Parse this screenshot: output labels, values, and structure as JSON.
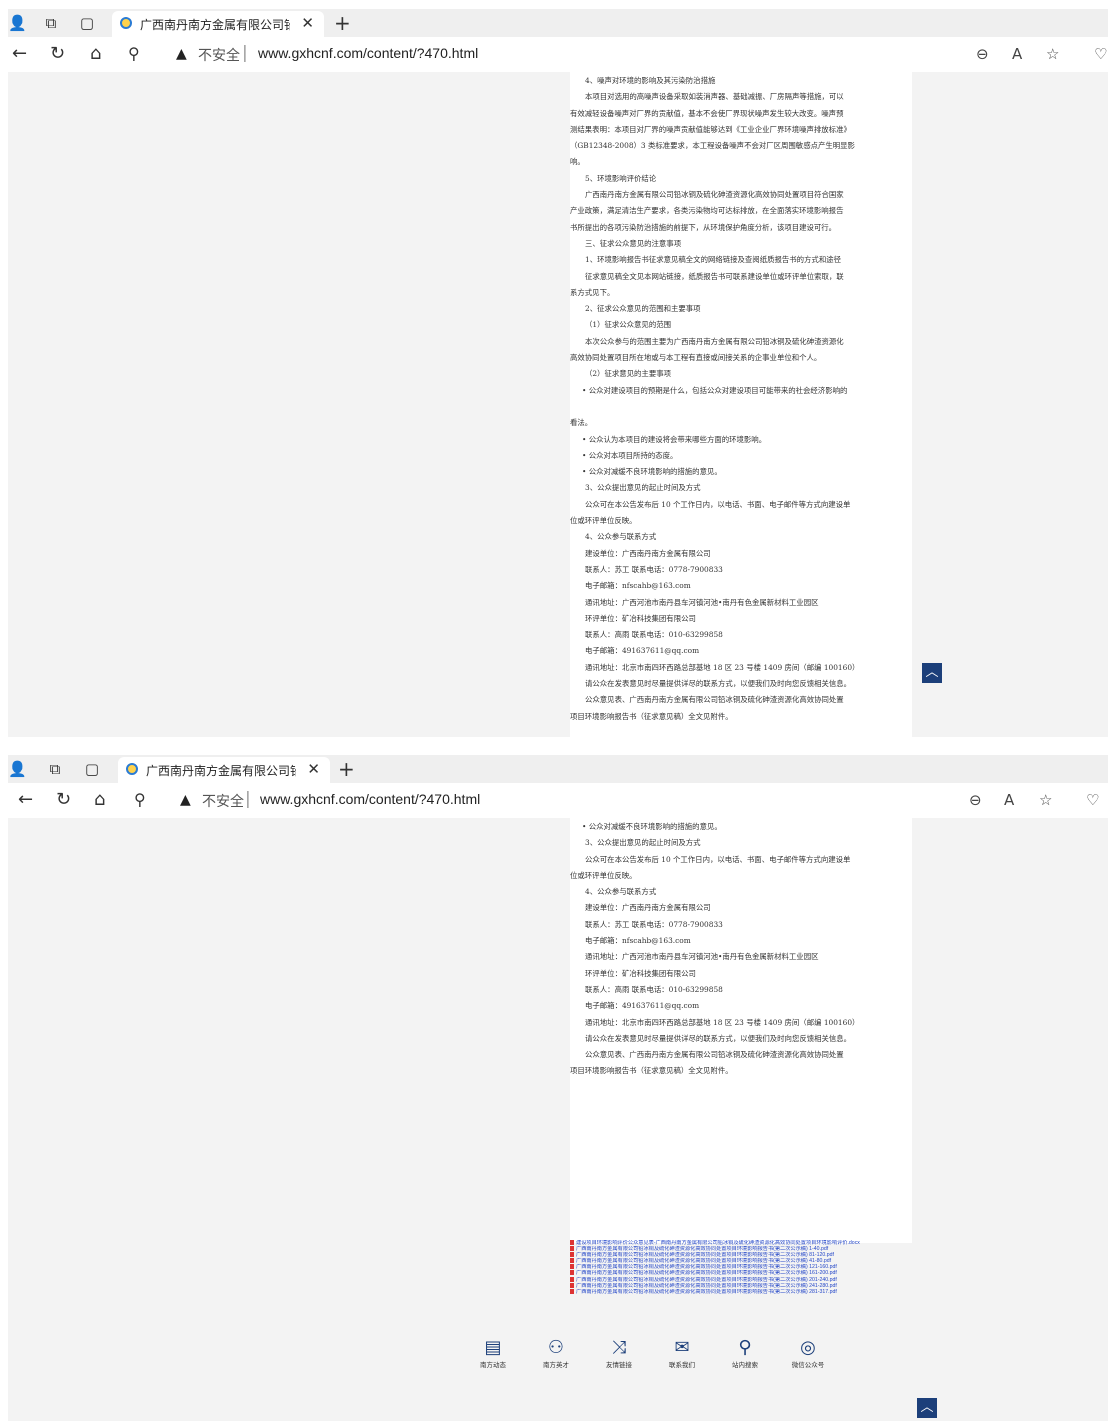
{
  "browser": {
    "tab_title": "广西南丹南方金属有限公司铅冰",
    "insecure_label": "不安全",
    "url": "www.gxhcnf.com/content/?470.html"
  },
  "article_top": [
    "4、噪声对环境的影响及其污染防治措施",
    "本项目对选用的高噪声设备采取如装消声器、基础减振、厂房隔声等措施，可以",
    "有效减轻设备噪声对厂界的贡献值，基本不会使厂界现状噪声发生较大改变。噪声预",
    "测结果表明：本项目对厂界的噪声贡献值能够达到《工业企业厂界环境噪声排放标准》",
    "（GB12348-2008）3 类标准要求，本工程设备噪声不会对厂区周围敏感点产生明显影",
    "响。",
    "5、环境影响评价结论",
    "广西南丹南方金属有限公司铅冰铜及硫化砷渣资源化高效协同处置项目符合国家",
    "产业政策，满足清洁生产要求，各类污染物均可达标排放，在全面落实环境影响报告",
    "书所提出的各项污染防治措施的前提下，从环境保护角度分析，该项目建设可行。",
    "三、征求公众意见的注意事项",
    "1、环境影响报告书征求意见稿全文的网络链接及查阅纸质报告书的方式和途径",
    "征求意见稿全文见本网站链接，纸质报告书可联系建设单位或环评单位索取，联",
    "系方式见下。",
    "2、征求公众意见的范围和主要事项",
    "（1）征求公众意见的范围",
    "本次公众参与的范围主要为广西南丹南方金属有限公司铅冰铜及硫化砷渣资源化",
    "高效协同处置项目所在地或与本工程有直接或间接关系的企事业单位和个人。",
    "（2）征求意见的主要事项",
    "• 公众对建设项目的预期是什么，包括公众对建设项目可能带来的社会经济影响的",
    "",
    "看法。",
    "• 公众认为本项目的建设将会带来哪些方面的环境影响。",
    "• 公众对本项目所持的态度。",
    "• 公众对减缓不良环境影响的措施的意见。",
    "3、公众提出意见的起止时间及方式",
    "公众可在本公告发布后 10 个工作日内，以电话、书面、电子邮件等方式向建设单",
    "位或环评单位反映。",
    "4、公众参与联系方式",
    "建设单位：广西南丹南方金属有限公司",
    "联系人：苏工          联系电话：0778-7900833",
    "电子邮箱：nfscahb@163.com",
    "通讯地址：广西河池市南丹县车河镇河池•南丹有色金属新材料工业园区",
    "环评单位：矿冶科技集团有限公司",
    "联系人：高雨          联系电话：010-63299858",
    "电子邮箱：491637611@qq.com",
    "通讯地址：北京市南四环西路总部基地 18 区 23 号楼 1409 房间（邮编 100160）",
    "请公众在发表意见时尽量提供详尽的联系方式，以便我们及时向您反馈相关信息。",
    "公众意见表、广西南丹南方金属有限公司铅冰铜及硫化砷渣资源化高效协同处置",
    "项目环境影响报告书（征求意见稿）全文见附件。"
  ],
  "article_bottom": [
    "• 公众对减缓不良环境影响的措施的意见。",
    "3、公众提出意见的起止时间及方式",
    "公众可在本公告发布后 10 个工作日内，以电话、书面、电子邮件等方式向建设单",
    "位或环评单位反映。",
    "4、公众参与联系方式",
    "建设单位：广西南丹南方金属有限公司",
    "联系人：苏工          联系电话：0778-7900833",
    "电子邮箱：nfscahb@163.com",
    "通讯地址：广西河池市南丹县车河镇河池•南丹有色金属新材料工业园区",
    "环评单位：矿冶科技集团有限公司",
    "联系人：高雨          联系电话：010-63299858",
    "电子邮箱：491637611@qq.com",
    "通讯地址：北京市南四环西路总部基地 18 区 23 号楼 1409 房间（邮编 100160）",
    "请公众在发表意见时尽量提供详尽的联系方式，以便我们及时向您反馈相关信息。",
    "公众意见表、广西南丹南方金属有限公司铅冰铜及硫化砷渣资源化高效协同处置",
    "项目环境影响报告书（征求意见稿）全文见附件。"
  ],
  "attachments": [
    "建设项目环境影响评价公众意见表-广西南丹南方金属有限公司铅冰铜及硫化砷渣资源化高效协同处置项目环境影响评价.docx",
    "广西南丹南方金属有限公司铅冰铜及硫化砷渣资源化高效协同处置项目环境影响报告书(第二次公示稿) 1-40.pdf",
    "广西南丹南方金属有限公司铅冰铜及硫化砷渣资源化高效协同处置项目环境影响报告书(第二次公示稿) 81-120.pdf",
    "广西南丹南方金属有限公司铅冰铜及硫化砷渣资源化高效协同处置项目环境影响报告书(第二次公示稿) 41-80.pdf",
    "广西南丹南方金属有限公司铅冰铜及硫化砷渣资源化高效协同处置项目环境影响报告书(第二次公示稿) 121-160.pdf",
    "广西南丹南方金属有限公司铅冰铜及硫化砷渣资源化高效协同处置项目环境影响报告书(第二次公示稿) 161-200.pdf",
    "广西南丹南方金属有限公司铅冰铜及硫化砷渣资源化高效协同处置项目环境影响报告书(第二次公示稿) 201-240.pdf",
    "广西南丹南方金属有限公司铅冰铜及硫化砷渣资源化高效协同处置项目环境影响报告书(第二次公示稿) 241-280.pdf",
    "广西南丹南方金属有限公司铅冰铜及硫化砷渣资源化高效协同处置项目环境影响报告书(第二次公示稿) 281-317.pdf"
  ],
  "footer_nav": [
    {
      "label": "南方动态",
      "icon": "news-icon"
    },
    {
      "label": "南方英才",
      "icon": "person-icon"
    },
    {
      "label": "友情链接",
      "icon": "shuffle-icon"
    },
    {
      "label": "联系我们",
      "icon": "mail-icon"
    },
    {
      "label": "站内搜索",
      "icon": "search-icon"
    },
    {
      "label": "微信公众号",
      "icon": "wechat-icon"
    }
  ],
  "colors": {
    "accent": "#1c3f7a",
    "link": "#2346c8"
  }
}
